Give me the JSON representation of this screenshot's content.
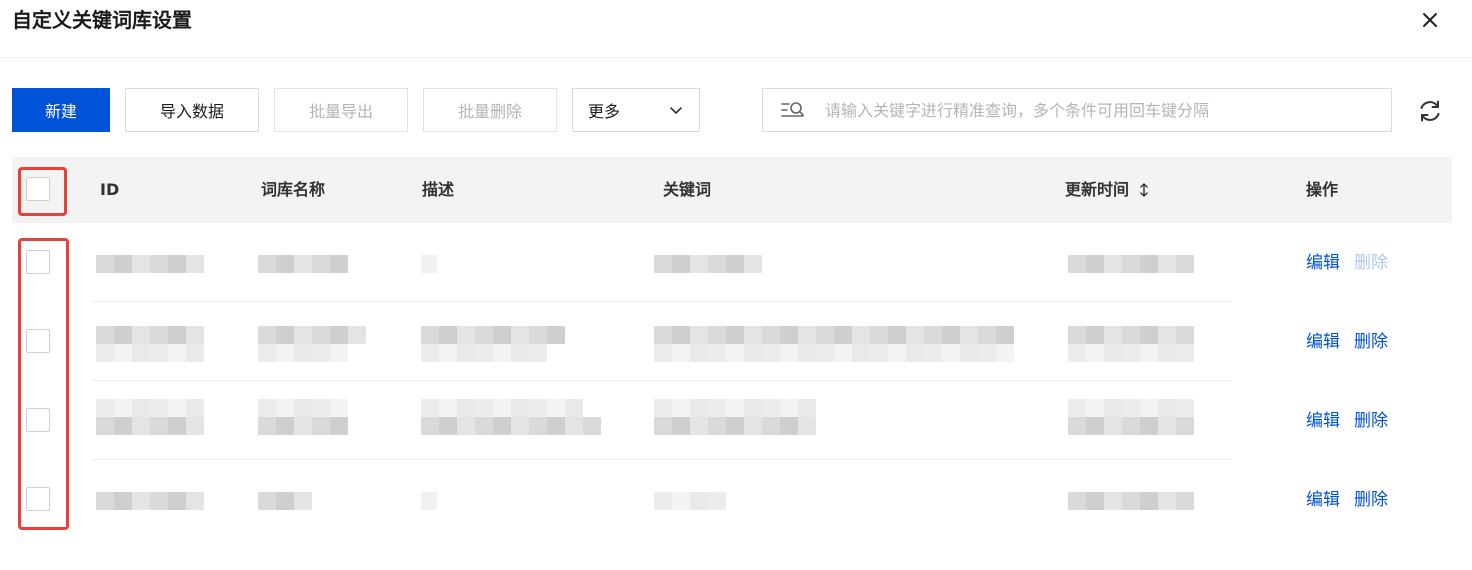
{
  "dialog": {
    "title": "自定义关键词库设置",
    "close_icon": "close-icon"
  },
  "toolbar": {
    "new_label": "新建",
    "import_label": "导入数据",
    "export_label": "批量导出",
    "batch_delete_label": "批量删除",
    "more_label": "更多",
    "search_placeholder": "请输入关键字进行精准查询，多个条件可用回车键分隔"
  },
  "table": {
    "columns": [
      "ID",
      "词库名称",
      "描述",
      "关键词",
      "更新时间",
      "操作"
    ],
    "rows": [
      {
        "edit": "编辑",
        "delete": "删除",
        "delete_disabled": true
      },
      {
        "edit": "编辑",
        "delete": "删除",
        "delete_disabled": false
      },
      {
        "edit": "编辑",
        "delete": "删除",
        "delete_disabled": false
      },
      {
        "edit": "编辑",
        "delete": "删除",
        "delete_disabled": false
      }
    ]
  },
  "colors": {
    "primary": "#0052d9",
    "highlight": "#e5433a",
    "disabled_link": "#b2c7ee"
  }
}
